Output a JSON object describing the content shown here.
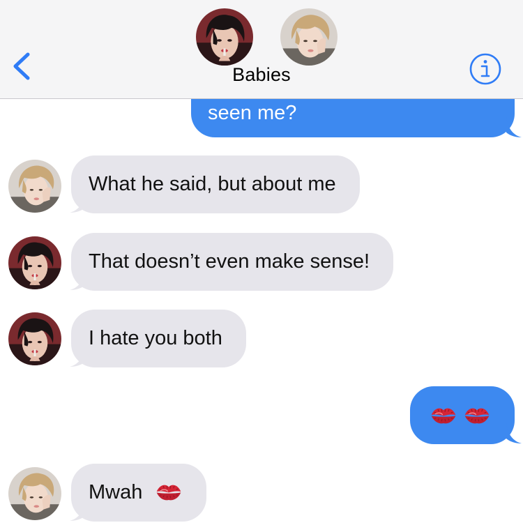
{
  "header": {
    "title": "Babies",
    "back_icon": "chevron-left-icon",
    "info_icon": "info-circle-icon",
    "participants": [
      {
        "avatar": "profile-photo-dark-hair"
      },
      {
        "avatar": "profile-photo-light-hair"
      }
    ]
  },
  "messages": [
    {
      "direction": "outgoing",
      "text": "seen me?"
    },
    {
      "direction": "incoming",
      "sender_avatar": "profile-photo-light-hair",
      "text": "What he said, but about me"
    },
    {
      "direction": "incoming",
      "sender_avatar": "profile-photo-dark-hair",
      "text": "That doesn’t even make sense!"
    },
    {
      "direction": "incoming",
      "sender_avatar": "profile-photo-dark-hair",
      "text": "I hate you both"
    },
    {
      "direction": "outgoing",
      "emoji": [
        "kiss-mark-emoji",
        "kiss-mark-emoji"
      ]
    },
    {
      "direction": "incoming",
      "sender_avatar": "profile-photo-light-hair",
      "text": "Mwah",
      "emoji": [
        "kiss-mark-emoji"
      ]
    }
  ],
  "colors": {
    "outgoing_bubble": "#3d89f0",
    "incoming_bubble": "#e6e5eb",
    "header_background": "#f5f5f6",
    "accent": "#2f7cf6",
    "kiss_red": "#d62536"
  }
}
